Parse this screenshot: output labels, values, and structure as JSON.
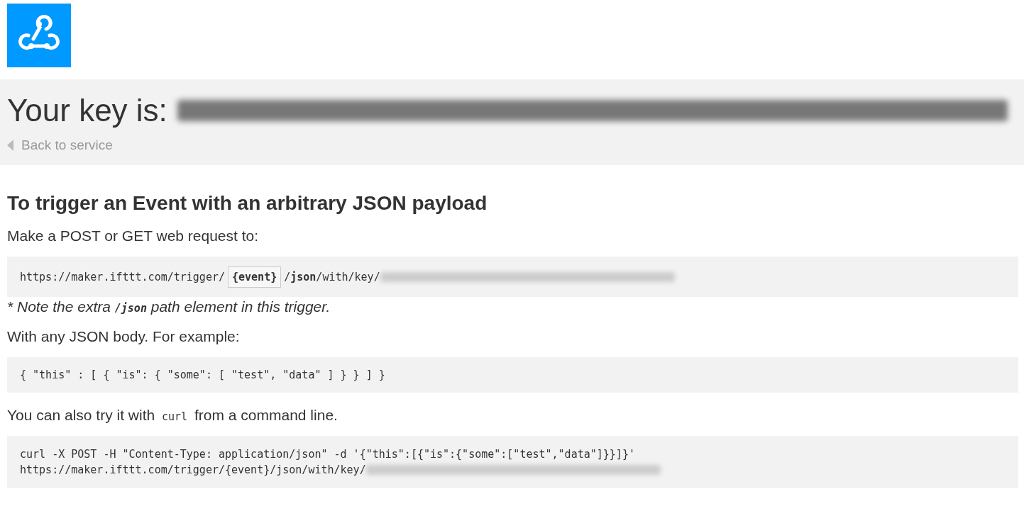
{
  "header": {
    "title": "Your key is:",
    "back_link": "Back to service"
  },
  "heading": "To trigger an Event with an arbitrary JSON payload",
  "intro": "Make a POST or GET web request to:",
  "url": {
    "prefix": "https://maker.ifttt.com/trigger/",
    "event": "{event}",
    "suffix": "/**json**/with/key/"
  },
  "note": {
    "before": "* Note the extra",
    "code": "/json",
    "after": "path element in this trigger."
  },
  "body_intro": "With any JSON body. For example:",
  "body_example": "{ \"this\" : [ { \"is\": { \"some\": [ \"test\", \"data\" ] } } ] }",
  "curl_intro": {
    "before": "You can also try it with",
    "code": "curl",
    "after": "from a command line."
  },
  "curl_lines": [
    "curl -X POST -H \"Content-Type: application/json\" -d '{\"this\":[{\"is\":{\"some\":[\"test\",\"data\"]}}]}'",
    "https://maker.ifttt.com/trigger/{event}/json/with/key/"
  ]
}
